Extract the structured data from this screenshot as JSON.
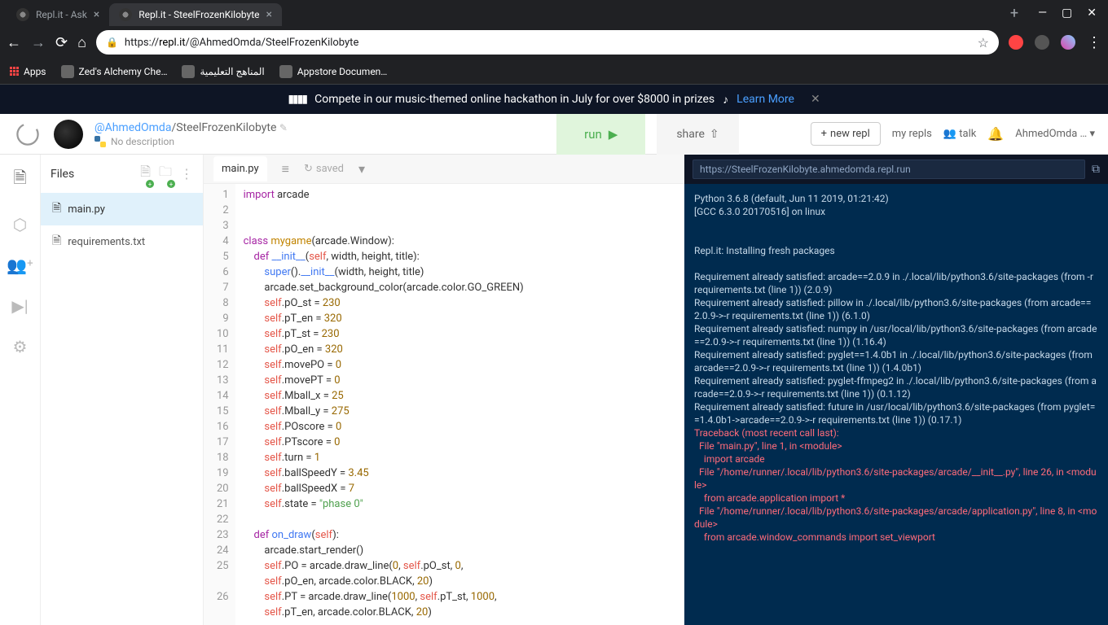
{
  "browser": {
    "tabs": [
      {
        "title": "Repl.it - Ask",
        "active": false
      },
      {
        "title": "Repl.it - SteelFrozenKilobyte",
        "active": true
      }
    ],
    "url_prefix": "https://",
    "url_domain": "repl.it",
    "url_path": "/@AhmedOmda/SteelFrozenKilobyte",
    "bookmarks": [
      {
        "label": "Apps",
        "icon": "grid"
      },
      {
        "label": "Zed's Alchemy Che…",
        "icon": "globe"
      },
      {
        "label": "المناهج التعليمية",
        "icon": "globe"
      },
      {
        "label": "Appstore Documen…",
        "icon": "amazon"
      }
    ]
  },
  "banner": {
    "text": "Compete in our music-themed online hackathon in July for over $8000 in prizes",
    "learn_more": "Learn More"
  },
  "header": {
    "user": "@AhmedOmda",
    "sep": "/",
    "repl": "SteelFrozenKilobyte",
    "no_desc": "No description",
    "run": "run",
    "share": "share",
    "new_repl": "new repl",
    "my_repls": "my repls",
    "talk": "talk",
    "account": "AhmedOmda …"
  },
  "files": {
    "title": "Files",
    "items": [
      {
        "name": "main.py",
        "active": true
      },
      {
        "name": "requirements.txt",
        "active": false
      }
    ]
  },
  "editor": {
    "tab": "main.py",
    "saved": "saved"
  },
  "code_lines": [
    {
      "n": 1,
      "html": "<span class='kw'>import</span> arcade"
    },
    {
      "n": 2,
      "html": ""
    },
    {
      "n": 3,
      "html": ""
    },
    {
      "n": 4,
      "html": "<span class='kw'>class</span> <span class='cls'>mygame</span>(arcade.Window):"
    },
    {
      "n": 5,
      "html": "    <span class='kw'>def</span> <span class='fn'>__init__</span>(<span class='self'>self</span>, width, height, title):"
    },
    {
      "n": 6,
      "html": "        <span class='fn'>super</span>().<span class='fn'>__init__</span>(width, height, title)"
    },
    {
      "n": 7,
      "html": "        arcade.set_background_color(arcade.color.GO_GREEN)"
    },
    {
      "n": 8,
      "html": "        <span class='self'>self</span>.pO_st = <span class='num'>230</span>"
    },
    {
      "n": 9,
      "html": "        <span class='self'>self</span>.pT_en = <span class='num'>320</span>"
    },
    {
      "n": 10,
      "html": "        <span class='self'>self</span>.pT_st = <span class='num'>230</span>"
    },
    {
      "n": 11,
      "html": "        <span class='self'>self</span>.pO_en = <span class='num'>320</span>"
    },
    {
      "n": 12,
      "html": "        <span class='self'>self</span>.movePO = <span class='num'>0</span>"
    },
    {
      "n": 13,
      "html": "        <span class='self'>self</span>.movePT = <span class='num'>0</span>"
    },
    {
      "n": 14,
      "html": "        <span class='self'>self</span>.Mball_x = <span class='num'>25</span>"
    },
    {
      "n": 15,
      "html": "        <span class='self'>self</span>.Mball_y = <span class='num'>275</span>"
    },
    {
      "n": 16,
      "html": "        <span class='self'>self</span>.POscore = <span class='num'>0</span>"
    },
    {
      "n": 17,
      "html": "        <span class='self'>self</span>.PTscore = <span class='num'>0</span>"
    },
    {
      "n": 18,
      "html": "        <span class='self'>self</span>.turn = <span class='num'>1</span>"
    },
    {
      "n": 19,
      "html": "        <span class='self'>self</span>.ballSpeedY = <span class='num'>3.45</span>"
    },
    {
      "n": 20,
      "html": "        <span class='self'>self</span>.ballSpeedX = <span class='num'>7</span>"
    },
    {
      "n": 21,
      "html": "        <span class='self'>self</span>.state = <span class='str'>\"phase 0\"</span>"
    },
    {
      "n": 22,
      "html": ""
    },
    {
      "n": 23,
      "html": "    <span class='kw'>def</span> <span class='fn'>on_draw</span>(<span class='self'>self</span>):"
    },
    {
      "n": 24,
      "html": "        arcade.start_render()"
    },
    {
      "n": 25,
      "html": "        <span class='self'>self</span>.PO = arcade.draw_line(<span class='num'>0</span>, <span class='self'>self</span>.pO_st, <span class='num'>0</span>,\n        <span class='self'>self</span>.pO_en, arcade.color.BLACK, <span class='num'>20</span>)"
    },
    {
      "n": 26,
      "html": "        <span class='self'>self</span>.PT = arcade.draw_line(<span class='num'>1000</span>, <span class='self'>self</span>.pT_st, <span class='num'>1000</span>,\n        <span class='self'>self</span>.pT_en, arcade.color.BLACK, <span class='num'>20</span>)"
    }
  ],
  "console": {
    "url": "https://SteelFrozenKilobyte.ahmedomda.repl.run",
    "plain": "Python 3.6.8 (default, Jun 11 2019, 01:21:42)\n[GCC 6.3.0 20170516] on linux\n\n\nRepl.it: Installing fresh packages\n\nRequirement already satisfied: arcade==2.0.9 in ./.local/lib/python3.6/site-packages (from -r requirements.txt (line 1)) (2.0.9)\nRequirement already satisfied: pillow in ./.local/lib/python3.6/site-packages (from arcade==2.0.9->-r requirements.txt (line 1)) (6.1.0)\nRequirement already satisfied: numpy in /usr/local/lib/python3.6/site-packages (from arcade==2.0.9->-r requirements.txt (line 1)) (1.16.4)\nRequirement already satisfied: pyglet==1.4.0b1 in ./.local/lib/python3.6/site-packages (from arcade==2.0.9->-r requirements.txt (line 1)) (1.4.0b1)\nRequirement already satisfied: pyglet-ffmpeg2 in ./.local/lib/python3.6/site-packages (from arcade==2.0.9->-r requirements.txt (line 1)) (0.1.12)\nRequirement already satisfied: future in /usr/local/lib/python3.6/site-packages (from pyglet==1.4.0b1->arcade==2.0.9->-r requirements.txt (line 1)) (0.17.1)",
    "err": "Traceback (most recent call last):\n  File \"main.py\", line 1, in <module>\n    import arcade\n  File \"/home/runner/.local/lib/python3.6/site-packages/arcade/__init__.py\", line 26, in <module>\n    from arcade.application import *\n  File \"/home/runner/.local/lib/python3.6/site-packages/arcade/application.py\", line 8, in <module>\n    from arcade.window_commands import set_viewport"
  }
}
